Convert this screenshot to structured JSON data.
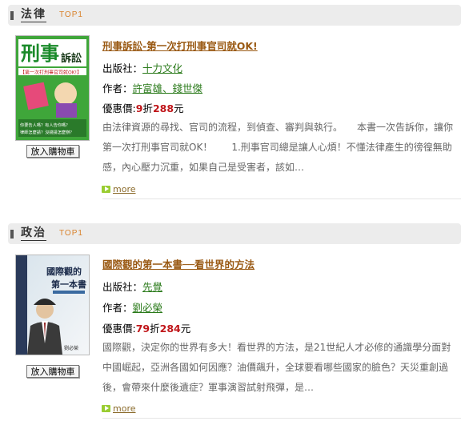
{
  "sections": [
    {
      "category": "法律",
      "badge": "TOP1",
      "title": "刑事訴訟-第一次打刑事官司就OK!",
      "publisher_label": "出版社：",
      "publisher": "十力文化",
      "author_label": "作者：",
      "authors": "許富雄、錢世傑",
      "price_label": "優惠價:",
      "discount": "9",
      "discount_unit": "折",
      "price": "288",
      "price_unit": "元",
      "description": "由法律資源的尋找、官司的流程，到偵查、審判與執行。　　本書一次告訴你，讓你第一次打刑事官司就OK！　　1.刑事官司總是讓人心煩！不懂法律產生的徬徨無助感，內心壓力沉重，如果自己是受害者，該如…",
      "more": "more",
      "cart_button": "放入購物車",
      "cover": {
        "title_big": "刑事",
        "title_small": "訴訟",
        "subtitle": "【第一次打刑事官司就OK!】",
        "question": "你要告人嗎？有人告你嗎？律師怎麼請？沒錢請怎麼辦？"
      }
    },
    {
      "category": "政治",
      "badge": "TOP1",
      "title": "國際觀的第一本書──看世界的方法",
      "publisher_label": "出版社：",
      "publisher": "先覺",
      "author_label": "作者：",
      "authors": "劉必榮",
      "price_label": "優惠價:",
      "discount": "79",
      "discount_unit": "折",
      "price": "284",
      "price_unit": "元",
      "description": "國際觀，決定你的世界有多大！看世界的方法，是21世紀人才必修的通識學分面對中國崛起，亞洲各國如何因應？油價飆升，全球要看哪些國家的臉色？天災重創過後，會帶來什麼後遺症？軍事演習試射飛彈，是…",
      "more": "more",
      "cart_button": "放入購物車",
      "cover": {
        "title_line1": "國際觀的",
        "title_line2": "第一本書",
        "author": "劉必榮"
      }
    }
  ],
  "colors": {
    "title": "#9a5a14",
    "link": "#2a7a1a",
    "price": "#c0161a",
    "badge": "#d9822b",
    "header_bg": "#ececec"
  }
}
